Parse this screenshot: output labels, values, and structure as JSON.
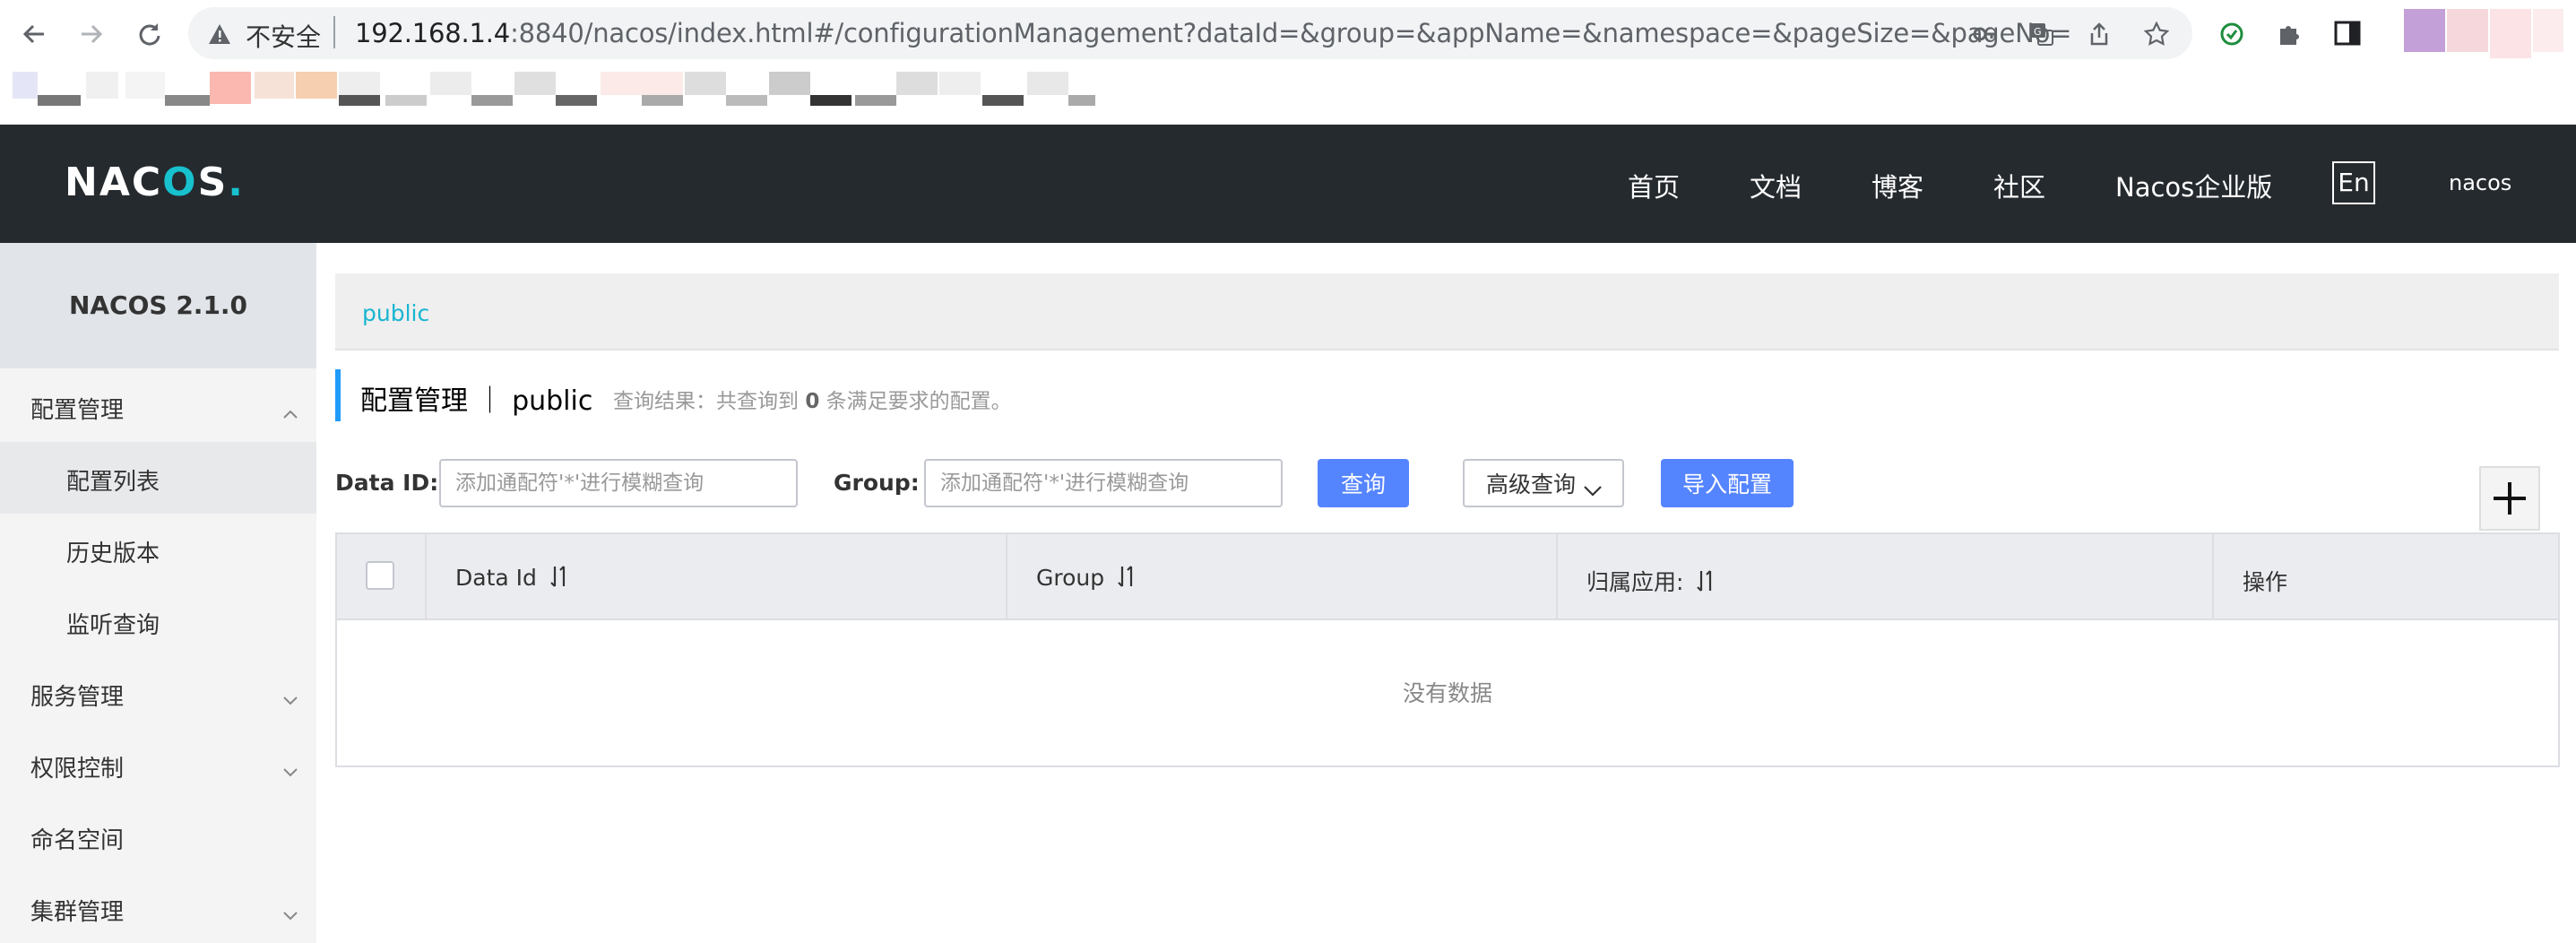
{
  "browser": {
    "insecure_label": "不安全",
    "url_host": "192.168.1.4",
    "url_rest": ":8840/nacos/index.html#/configurationManagement?dataId=&group=&appName=&namespace=&pageSize=&pageNo="
  },
  "header": {
    "logo_pre": "NAC",
    "logo_o": "O",
    "logo_post": "S",
    "logo_dot": ".",
    "nav": [
      "首页",
      "文档",
      "博客",
      "社区",
      "Nacos企业版"
    ],
    "lang": "En",
    "user": "nacos"
  },
  "sidebar": {
    "title": "NACOS 2.1.0",
    "items": [
      {
        "label": "配置管理"
      },
      {
        "label": "配置列表"
      },
      {
        "label": "历史版本"
      },
      {
        "label": "监听查询"
      },
      {
        "label": "服务管理"
      },
      {
        "label": "权限控制"
      },
      {
        "label": "命名空间"
      },
      {
        "label": "集群管理"
      }
    ]
  },
  "main": {
    "namespace_tab": "public",
    "title": "配置管理 ｜ public",
    "query_prefix": "查询结果：共查询到 ",
    "query_count": "0",
    "query_suffix": " 条满足要求的配置。",
    "filters": {
      "data_id_label": "Data ID:",
      "data_id_placeholder": "添加通配符'*'进行模糊查询",
      "group_label": "Group:",
      "group_placeholder": "添加通配符'*'进行模糊查询",
      "search_button": "查询",
      "advanced_button": "高级查询",
      "import_button": "导入配置"
    },
    "table": {
      "columns": [
        "Data Id",
        "Group",
        "归属应用:",
        "操作"
      ],
      "empty_text": "没有数据"
    }
  }
}
